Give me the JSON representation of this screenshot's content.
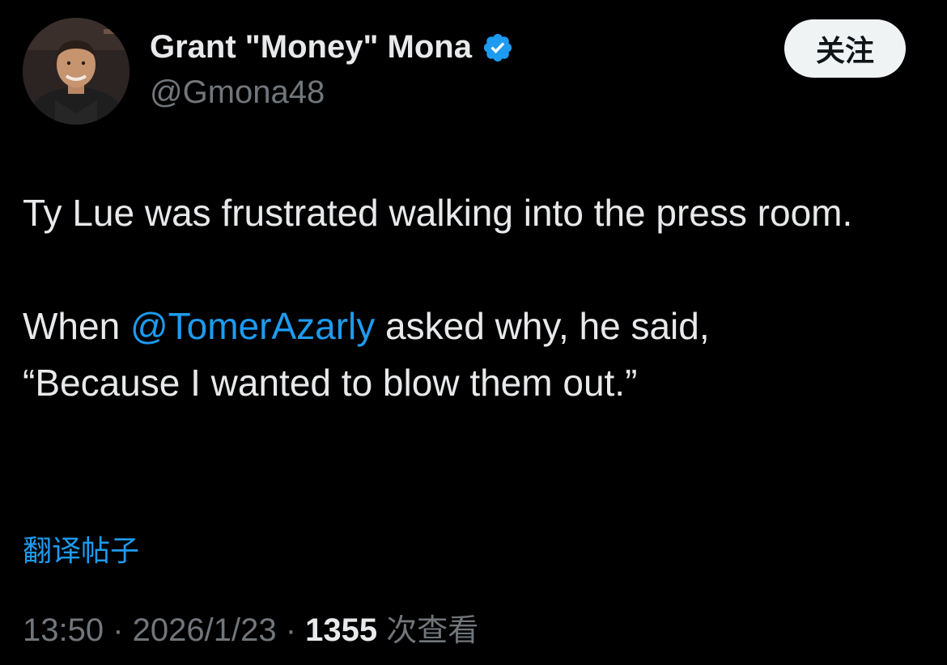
{
  "author": {
    "display_name": "Grant \"Money\" Mona",
    "handle": "@Gmona48",
    "verified_icon": "verified-badge-icon",
    "avatar_icon": "profile-photo"
  },
  "follow_button": {
    "label": "关注"
  },
  "tweet": {
    "paragraph1": "Ty Lue was frustrated walking into the press room.",
    "paragraph2_prefix": "When ",
    "mention": "@TomerAzarly",
    "paragraph2_suffix": " asked why, he said,",
    "paragraph2_quote": "“Because I wanted to blow them out.”"
  },
  "translate": {
    "label": "翻译帖子"
  },
  "meta": {
    "time": "13:50",
    "separator": " · ",
    "date": "2026/1/23",
    "views_count": "1355",
    "views_label": "次查看"
  },
  "colors": {
    "background": "#000000",
    "text_primary": "#e7e9ea",
    "text_secondary": "#71767b",
    "accent_blue": "#1d9bf0",
    "button_bg": "#eff3f4"
  }
}
